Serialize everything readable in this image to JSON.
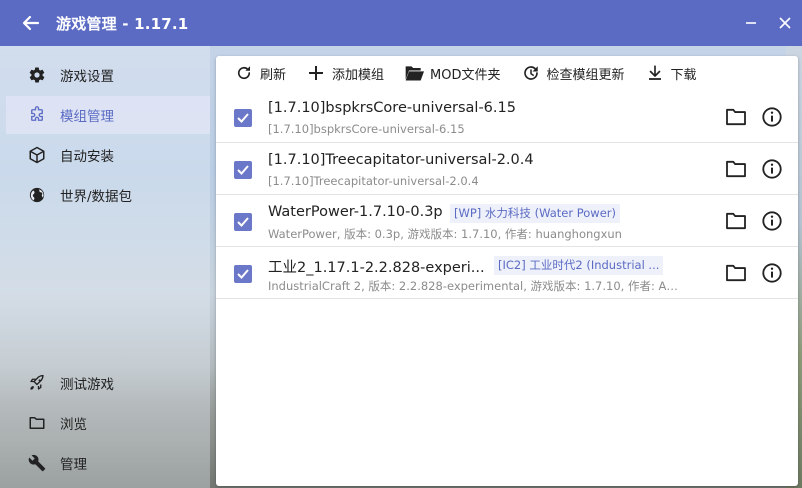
{
  "window": {
    "title": "游戏管理 - 1.17.1",
    "accent_color": "#5b6bc4"
  },
  "sidebar": {
    "items": [
      {
        "label": "游戏设置",
        "icon": "gear-icon"
      },
      {
        "label": "模组管理",
        "icon": "puzzle-icon",
        "active": true
      },
      {
        "label": "自动安装",
        "icon": "cube-icon"
      },
      {
        "label": "世界/数据包",
        "icon": "globe-icon"
      }
    ],
    "bottom_items": [
      {
        "label": "测试游戏",
        "icon": "rocket-icon"
      },
      {
        "label": "浏览",
        "icon": "folder-icon"
      },
      {
        "label": "管理",
        "icon": "wrench-icon"
      }
    ]
  },
  "toolbar": {
    "refresh": "刷新",
    "add_mod": "添加模组",
    "mod_folder": "MOD文件夹",
    "check_updates": "检查模组更新",
    "download": "下载"
  },
  "mods": [
    {
      "name": "[1.7.10]bspkrsCore-universal-6.15",
      "sub": "[1.7.10]bspkrsCore-universal-6.15",
      "tag": "",
      "checked": true
    },
    {
      "name": "[1.7.10]Treecapitator-universal-2.0.4",
      "sub": "[1.7.10]Treecapitator-universal-2.0.4",
      "tag": "",
      "checked": true
    },
    {
      "name": "WaterPower-1.7.10-0.3p",
      "sub": "WaterPower, 版本: 0.3p, 游戏版本: 1.7.10, 作者: huanghongxun",
      "tag": "[WP] 水力科技 (Water Power)",
      "checked": true
    },
    {
      "name": "工业2_1.17.1-2.2.828-experi...",
      "sub": "IndustrialCraft 2, 版本: 2.2.828-experimental, 游戏版本: 1.7.10, 作者: Al...",
      "tag": "[IC2] 工业时代2 (Industrial ...",
      "checked": true
    }
  ]
}
